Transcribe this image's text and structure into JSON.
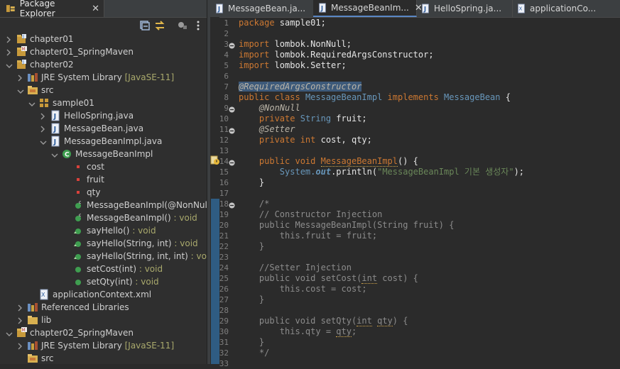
{
  "package_explorer": {
    "tab_label": "Package Explorer",
    "close_glyph": "✕",
    "tree": [
      {
        "label": "chapter01",
        "deco": "",
        "ret": "",
        "icon": "project-icon",
        "level": 0,
        "arrow": "right"
      },
      {
        "label": "chapter01_SpringMaven",
        "deco": "",
        "ret": "",
        "icon": "maven-project-icon",
        "level": 0,
        "arrow": "right"
      },
      {
        "label": "chapter02",
        "deco": "",
        "ret": "",
        "icon": "project-icon",
        "level": 0,
        "arrow": "down"
      },
      {
        "label": "JRE System Library",
        "deco": " [JavaSE-11]",
        "ret": "",
        "icon": "library-icon",
        "level": 1,
        "arrow": "right"
      },
      {
        "label": "src",
        "deco": "",
        "ret": "",
        "icon": "source-folder-icon",
        "level": 1,
        "arrow": "down"
      },
      {
        "label": "sample01",
        "deco": "",
        "ret": "",
        "icon": "package-icon",
        "level": 2,
        "arrow": "down"
      },
      {
        "label": "HelloSpring.java",
        "deco": "",
        "ret": "",
        "icon": "java-file-icon",
        "level": 3,
        "arrow": "right"
      },
      {
        "label": "MessageBean.java",
        "deco": "",
        "ret": "",
        "icon": "java-file-icon",
        "level": 3,
        "arrow": "right"
      },
      {
        "label": "MessageBeanImpl.java",
        "deco": "",
        "ret": "",
        "icon": "java-file-icon",
        "level": 3,
        "arrow": "down"
      },
      {
        "label": "MessageBeanImpl",
        "deco": "",
        "ret": "",
        "icon": "class-icon",
        "level": 4,
        "arrow": "down"
      },
      {
        "label": "cost",
        "deco": "",
        "ret": "",
        "icon": "private-field-icon",
        "level": 5,
        "arrow": ""
      },
      {
        "label": "fruit",
        "deco": "",
        "ret": "",
        "icon": "private-field-icon",
        "level": 5,
        "arrow": ""
      },
      {
        "label": "qty",
        "deco": "",
        "ret": "",
        "icon": "private-field-icon",
        "level": 5,
        "arrow": ""
      },
      {
        "label": "MessageBeanImpl(@NonNull S",
        "deco": "",
        "ret": "",
        "icon": "constructor-icon",
        "level": 5,
        "arrow": ""
      },
      {
        "label": "MessageBeanImpl()",
        "deco": "",
        "ret": " : void",
        "icon": "constructor-icon",
        "level": 5,
        "arrow": ""
      },
      {
        "label": "sayHello()",
        "deco": "",
        "ret": " : void",
        "icon": "method-override-icon",
        "level": 5,
        "arrow": ""
      },
      {
        "label": "sayHello(String, int)",
        "deco": "",
        "ret": " : void",
        "icon": "method-override-icon",
        "level": 5,
        "arrow": ""
      },
      {
        "label": "sayHello(String, int, int)",
        "deco": "",
        "ret": " : void",
        "icon": "method-override-icon",
        "level": 5,
        "arrow": ""
      },
      {
        "label": "setCost(int)",
        "deco": "",
        "ret": " : void",
        "icon": "public-method-icon",
        "level": 5,
        "arrow": ""
      },
      {
        "label": "setQty(int)",
        "deco": "",
        "ret": " : void",
        "icon": "public-method-icon",
        "level": 5,
        "arrow": ""
      },
      {
        "label": "applicationContext.xml",
        "deco": "",
        "ret": "",
        "icon": "xml-file-icon",
        "level": 2,
        "arrow": ""
      },
      {
        "label": "Referenced Libraries",
        "deco": "",
        "ret": "",
        "icon": "library-icon",
        "level": 1,
        "arrow": "right"
      },
      {
        "label": "lib",
        "deco": "",
        "ret": "",
        "icon": "folder-icon",
        "level": 1,
        "arrow": "right"
      },
      {
        "label": "chapter02_SpringMaven",
        "deco": "",
        "ret": "",
        "icon": "maven-project-icon",
        "level": 0,
        "arrow": "down"
      },
      {
        "label": "JRE System Library",
        "deco": " [JavaSE-11]",
        "ret": "",
        "icon": "library-icon",
        "level": 1,
        "arrow": "right"
      },
      {
        "label": "src",
        "deco": "",
        "ret": "",
        "icon": "source-folder-icon",
        "level": 1,
        "arrow": ""
      }
    ]
  },
  "editor": {
    "tabs": [
      {
        "label": "MessageBean.ja...",
        "icon": "java-file-icon",
        "active": false,
        "close": ""
      },
      {
        "label": "MessageBeanIm...",
        "icon": "java-file-icon",
        "active": true,
        "close": "✕"
      },
      {
        "label": "HelloSpring.ja...",
        "icon": "java-file-icon",
        "active": false,
        "close": ""
      },
      {
        "label": "applicationCo...",
        "icon": "xml-file-icon",
        "active": false,
        "close": ""
      }
    ],
    "lines": [
      {
        "n": "1",
        "fold": false,
        "segs": [
          [
            "kw",
            "package"
          ],
          [
            "tx",
            " sample01;"
          ]
        ]
      },
      {
        "n": "2",
        "fold": false,
        "segs": []
      },
      {
        "n": "3",
        "fold": true,
        "segs": [
          [
            "kw",
            "import"
          ],
          [
            "tx",
            " lombok.NonNull;"
          ]
        ]
      },
      {
        "n": "4",
        "fold": false,
        "segs": [
          [
            "kw",
            "import"
          ],
          [
            "tx",
            " lombok.RequiredArgsConstructor;"
          ]
        ]
      },
      {
        "n": "5",
        "fold": false,
        "segs": [
          [
            "kw",
            "import"
          ],
          [
            "tx",
            " lombok.Setter;"
          ]
        ]
      },
      {
        "n": "6",
        "fold": false,
        "segs": []
      },
      {
        "n": "7",
        "fold": false,
        "segs": [
          [
            "an hlsel",
            "@RequiredArgsConstructor"
          ]
        ]
      },
      {
        "n": "8",
        "fold": false,
        "segs": [
          [
            "kw",
            "public class"
          ],
          [
            "tx",
            " "
          ],
          [
            "tp",
            "MessageBeanImpl"
          ],
          [
            "tx",
            " "
          ],
          [
            "kw",
            "implements"
          ],
          [
            "tx",
            " "
          ],
          [
            "tp",
            "MessageBean"
          ],
          [
            "tx",
            " {"
          ]
        ]
      },
      {
        "n": "9",
        "fold": true,
        "segs": [
          [
            "tx",
            "    "
          ],
          [
            "an",
            "@NonNull"
          ]
        ]
      },
      {
        "n": "10",
        "fold": false,
        "segs": [
          [
            "tx",
            "    "
          ],
          [
            "kw",
            "private"
          ],
          [
            "tx",
            " "
          ],
          [
            "tp",
            "String"
          ],
          [
            "tx",
            " fruit;"
          ]
        ]
      },
      {
        "n": "11",
        "fold": true,
        "segs": [
          [
            "tx",
            "    "
          ],
          [
            "an",
            "@Setter"
          ]
        ]
      },
      {
        "n": "12",
        "fold": false,
        "segs": [
          [
            "tx",
            "    "
          ],
          [
            "kw",
            "private int"
          ],
          [
            "tx",
            " cost, qty;"
          ]
        ]
      },
      {
        "n": "13",
        "fold": false,
        "segs": []
      },
      {
        "n": "14",
        "fold": true,
        "segs": [
          [
            "tx",
            "    "
          ],
          [
            "kw",
            "public void"
          ],
          [
            "tx",
            " "
          ],
          [
            "kw warn",
            "MessageBeanImpl"
          ],
          [
            "tx",
            "() {"
          ]
        ]
      },
      {
        "n": "15",
        "fold": false,
        "segs": [
          [
            "tx",
            "        "
          ],
          [
            "tp",
            "System."
          ],
          [
            "tp bold-i",
            "out"
          ],
          [
            "tx",
            ".println("
          ],
          [
            "str",
            "\"MessageBeanImpl 기본 생성자\""
          ],
          [
            "tx",
            ");"
          ]
        ]
      },
      {
        "n": "16",
        "fold": false,
        "segs": [
          [
            "tx",
            "    }"
          ]
        ]
      },
      {
        "n": "17",
        "fold": false,
        "segs": []
      },
      {
        "n": "18",
        "fold": true,
        "segs": [
          [
            "cm",
            "    /*"
          ]
        ]
      },
      {
        "n": "19",
        "fold": false,
        "segs": [
          [
            "cm",
            "    // Constructor Injection"
          ]
        ]
      },
      {
        "n": "20",
        "fold": false,
        "segs": [
          [
            "cm",
            "    public MessageBeanImpl(String fruit) {"
          ]
        ]
      },
      {
        "n": "21",
        "fold": false,
        "segs": [
          [
            "cm",
            "        this.fruit = fruit;"
          ]
        ]
      },
      {
        "n": "22",
        "fold": false,
        "segs": [
          [
            "cm",
            "    }"
          ]
        ]
      },
      {
        "n": "23",
        "fold": false,
        "segs": []
      },
      {
        "n": "24",
        "fold": false,
        "segs": [
          [
            "cm",
            "    //Setter Injection"
          ]
        ]
      },
      {
        "n": "25",
        "fold": false,
        "segs": [
          [
            "cm",
            "    public void setCost("
          ],
          [
            "cm warn",
            "int"
          ],
          [
            "cm",
            " cost) {"
          ]
        ]
      },
      {
        "n": "26",
        "fold": false,
        "segs": [
          [
            "cm",
            "        this.cost = cost;"
          ]
        ]
      },
      {
        "n": "27",
        "fold": false,
        "segs": [
          [
            "cm",
            "    }"
          ]
        ]
      },
      {
        "n": "28",
        "fold": false,
        "segs": []
      },
      {
        "n": "29",
        "fold": false,
        "segs": [
          [
            "cm",
            "    public void setQty("
          ],
          [
            "cm warn",
            "int"
          ],
          [
            "cm",
            " "
          ],
          [
            "cm warn",
            "qty"
          ],
          [
            "cm",
            ") {"
          ]
        ]
      },
      {
        "n": "30",
        "fold": false,
        "segs": [
          [
            "cm",
            "        this.qty = "
          ],
          [
            "cm warn",
            "qty"
          ],
          [
            "cm",
            ";"
          ]
        ]
      },
      {
        "n": "31",
        "fold": false,
        "segs": [
          [
            "cm",
            "    }"
          ]
        ]
      },
      {
        "n": "32",
        "fold": false,
        "segs": [
          [
            "cm",
            "    */"
          ]
        ]
      },
      {
        "n": "33",
        "fold": false,
        "segs": []
      }
    ]
  },
  "colors": {
    "keyword": "#cc7832",
    "type": "#6897bb",
    "string": "#6a8759",
    "comment": "#8c8c8c",
    "fold_band": "#2f5c82"
  }
}
